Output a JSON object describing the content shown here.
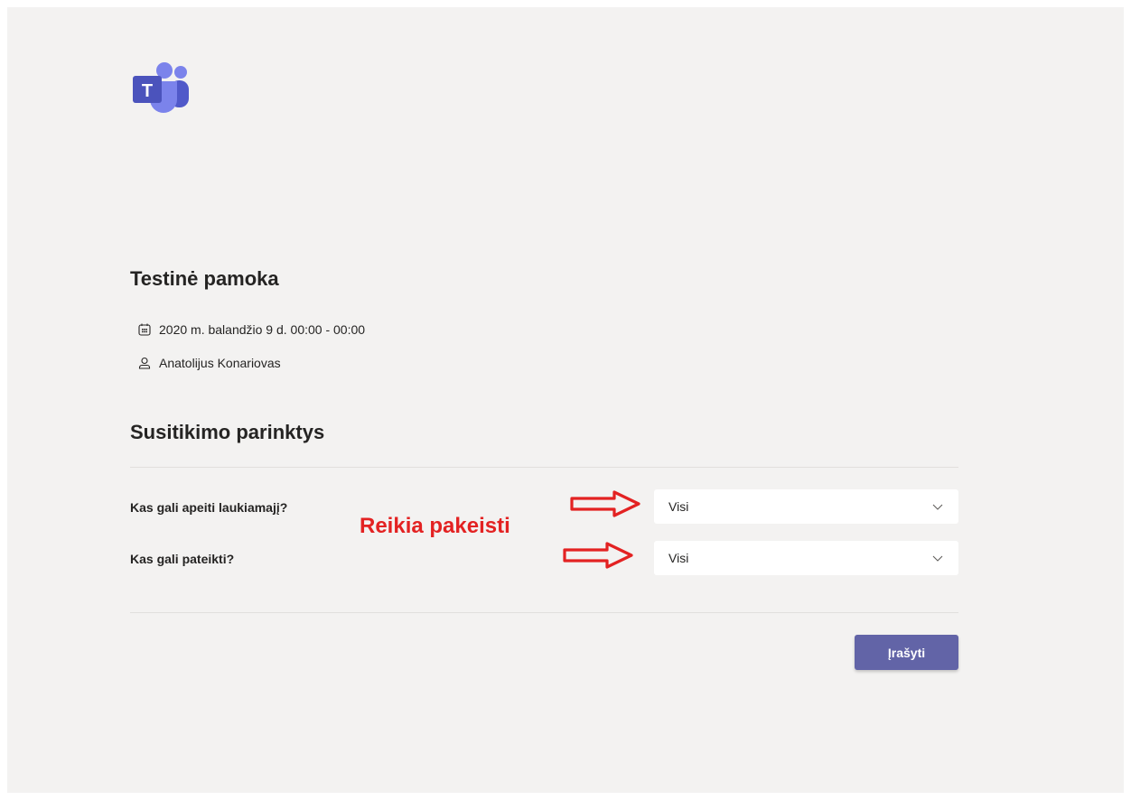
{
  "app": {
    "logo_icon": "microsoft-teams-logo",
    "logo_letter": "T",
    "brand_color": "#6264a7"
  },
  "meeting": {
    "title": "Testinė pamoka",
    "datetime": "2020 m. balandžio 9 d. 00:00 - 00:00",
    "datetime_icon": "calendar-icon",
    "organizer": "Anatolijus Konariovas",
    "organizer_icon": "person-icon"
  },
  "options": {
    "section_title": "Susitikimo parinktys",
    "lobby": {
      "label": "Kas gali apeiti laukiamajį?",
      "value": "Visi"
    },
    "presenters": {
      "label": "Kas gali pateikti?",
      "value": "Visi"
    }
  },
  "annotation": {
    "text": "Reikia pakeisti",
    "color": "#e32222"
  },
  "actions": {
    "save_label": "Įrašyti"
  }
}
